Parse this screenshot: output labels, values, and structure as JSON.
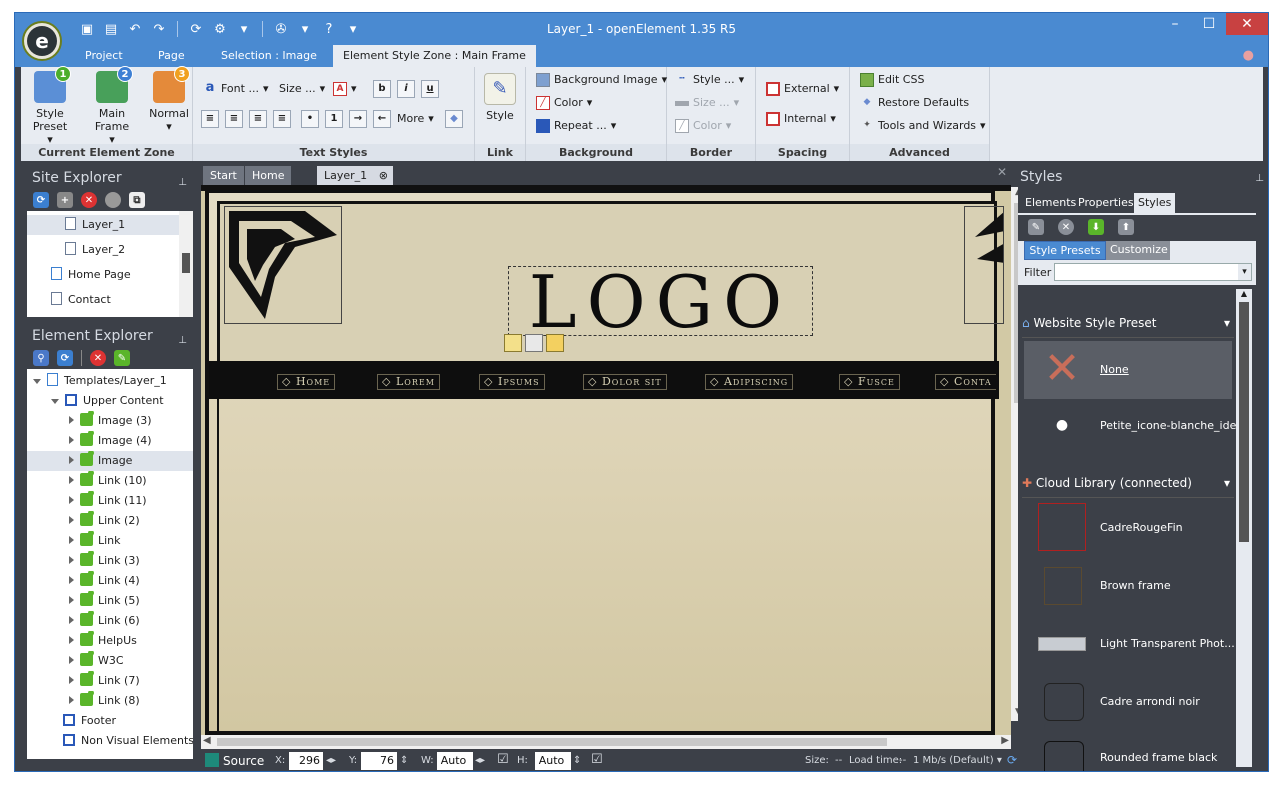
{
  "window": {
    "title": "Layer_1 - openElement 1.35 R5"
  },
  "app_logo": "e",
  "ribbon_tabs": [
    "Project",
    "Page",
    "Selection : Image",
    "Element Style Zone : Main Frame"
  ],
  "ribbon": {
    "current_zone": {
      "label": "Current Element Zone",
      "style_preset": "Style Preset",
      "main_frame": "Main Frame",
      "normal": "Normal",
      "badges": [
        "1",
        "2",
        "3"
      ]
    },
    "text_styles": {
      "label": "Text Styles",
      "font": "Font ...",
      "size": "Size ...",
      "bold": "b",
      "italic": "i",
      "underline": "u",
      "more": "More"
    },
    "link": {
      "label": "Link",
      "style": "Style"
    },
    "background": {
      "label": "Background",
      "image": "Background Image",
      "color": "Color",
      "repeat": "Repeat ..."
    },
    "border": {
      "label": "Border",
      "style": "Style ...",
      "size": "Size ...",
      "color": "Color"
    },
    "spacing": {
      "label": "Spacing",
      "external": "External",
      "internal": "Internal"
    },
    "advanced": {
      "label": "Advanced",
      "edit_css": "Edit CSS",
      "restore": "Restore Defaults",
      "tools": "Tools and Wizards"
    }
  },
  "site_explorer": {
    "title": "Site Explorer",
    "items": [
      "Layer_1",
      "Layer_2",
      "Home Page",
      "Contact"
    ]
  },
  "element_explorer": {
    "title": "Element Explorer",
    "root": "Templates/Layer_1",
    "upper": "Upper Content",
    "children": [
      "Image (3)",
      "Image (4)",
      "Image",
      "Link (10)",
      "Link (11)",
      "Link (2)",
      "Link",
      "Link (3)",
      "Link (4)",
      "Link (5)",
      "Link (6)",
      "HelpUs",
      "W3C",
      "Link (7)",
      "Link (8)"
    ],
    "footer": "Footer",
    "non_visual": "Non Visual Elements"
  },
  "doc_tabs": [
    "Start",
    "Home Page",
    "Layer_1"
  ],
  "page": {
    "logo": "LOGO",
    "nav": [
      "Home",
      "Lorem",
      "Ipsums",
      "Dolor sit",
      "Adipiscing",
      "Fusce",
      "Conta"
    ]
  },
  "status": {
    "source": "Source",
    "x_label": "X:",
    "x": "296",
    "y_label": "Y:",
    "y": "76",
    "w_label": "W:",
    "w": "Auto",
    "h_label": "H:",
    "h": "Auto",
    "size_label": "Size:",
    "size": "--",
    "load_label": "Load time:",
    "load": "--",
    "speed": "1 Mb/s (Default)"
  },
  "styles_panel": {
    "title": "Styles",
    "tabs": [
      "Elements",
      "Properties",
      "Styles"
    ],
    "subtabs": [
      "Style Presets",
      "Customize"
    ],
    "filter_label": "Filter",
    "filter_value": "",
    "sections": [
      "Website Style Preset",
      "Cloud Library (connected)"
    ],
    "website_items": [
      "None",
      "Petite_icone-blanche_idee"
    ],
    "cloud_items": [
      "CadreRougeFin",
      "Brown frame",
      "Light Transparent Phot...",
      "Cadre arrondi noir",
      "Rounded frame black"
    ]
  },
  "colors": {
    "titlebar": "#4a8ad1",
    "panel": "#3c4048",
    "ribbon": "#e8ecf2",
    "close": "#c84141"
  }
}
